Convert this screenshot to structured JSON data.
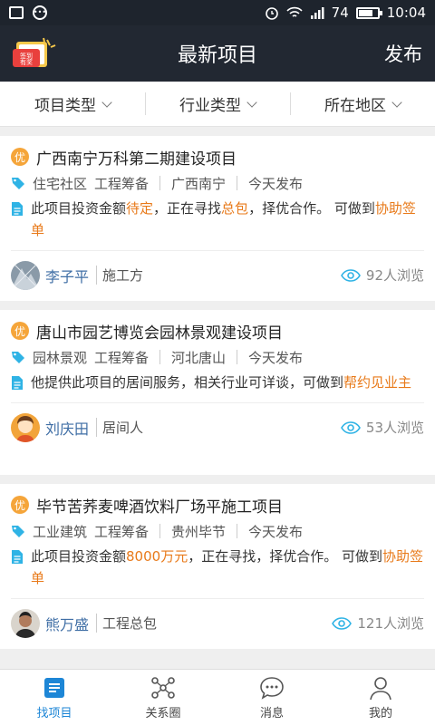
{
  "status_bar": {
    "signal": "74",
    "time": "10:04",
    "battery_level": 0.74
  },
  "header": {
    "checkin_badge": "签到有奖",
    "title": "最新项目",
    "publish_label": "发布"
  },
  "filters": [
    {
      "label": "项目类型"
    },
    {
      "label": "行业类型"
    },
    {
      "label": "所在地区"
    }
  ],
  "projects": [
    {
      "badge": "优",
      "title": "广西南宁万科第二期建设项目",
      "category": "住宅社区",
      "stage": "工程筹备",
      "location": "广西南宁",
      "date": "今天发布",
      "desc_parts": [
        {
          "text": "此项目投资金额",
          "hl": false
        },
        {
          "text": "待定",
          "hl": true
        },
        {
          "text": "，正在寻找",
          "hl": false
        },
        {
          "text": "总包",
          "hl": true
        },
        {
          "text": "，择优合作。 可做到",
          "hl": false
        },
        {
          "text": "协助签单",
          "hl": true
        }
      ],
      "user": "李子平",
      "role": "施工方",
      "views": "92人浏览"
    },
    {
      "badge": "优",
      "title": "唐山市园艺博览会园林景观建设项目",
      "category": "园林景观",
      "stage": "工程筹备",
      "location": "河北唐山",
      "date": "今天发布",
      "desc_parts": [
        {
          "text": "他提供此项目的居间服务，相关行业可详谈，可做到",
          "hl": false
        },
        {
          "text": "帮约见业主",
          "hl": true
        }
      ],
      "user": "刘庆田",
      "role": "居间人",
      "views": "53人浏览"
    },
    {
      "badge": "优",
      "title": "毕节苦荞麦啤酒饮料厂场平施工项目",
      "category": "工业建筑",
      "stage": "工程筹备",
      "location": "贵州毕节",
      "date": "今天发布",
      "desc_parts": [
        {
          "text": "此项目投资金额",
          "hl": false
        },
        {
          "text": "8000万元",
          "hl": true
        },
        {
          "text": "，正在寻找，择优合作。 可做到",
          "hl": false
        },
        {
          "text": "协助签单",
          "hl": true
        }
      ],
      "user": "熊万盛",
      "role": "工程总包",
      "views": "121人浏览"
    }
  ],
  "tabs": [
    {
      "label": "找项目",
      "icon": "find-project-icon",
      "active": true
    },
    {
      "label": "关系圈",
      "icon": "network-icon",
      "active": false
    },
    {
      "label": "消息",
      "icon": "message-icon",
      "active": false
    },
    {
      "label": "我的",
      "icon": "profile-icon",
      "active": false
    }
  ],
  "colors": {
    "accent": "#1d86d6",
    "highlight": "#e87a1a",
    "tag": "#2fb3e5",
    "header_bg": "#222832"
  }
}
